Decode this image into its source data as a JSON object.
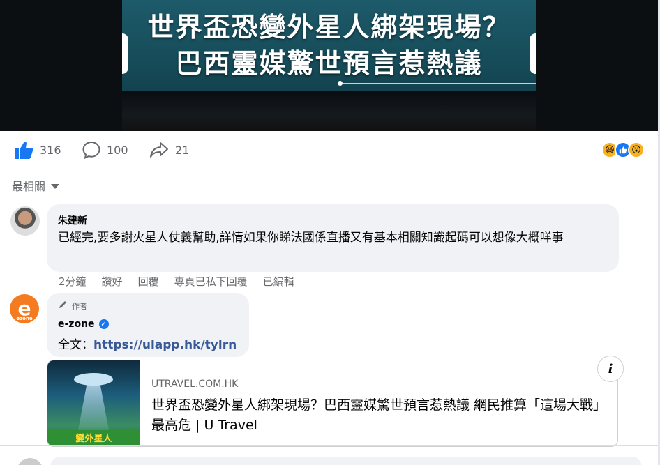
{
  "video": {
    "headline_line1": "世界盃恐變外星人綁架現場？",
    "headline_line2": "巴西靈媒驚世預言惹熱議"
  },
  "actions": {
    "likes": "316",
    "comments": "100",
    "shares": "21",
    "reactions": [
      "laugh",
      "like",
      "wow"
    ]
  },
  "sort": {
    "label": "最相關"
  },
  "comments": [
    {
      "author": "朱建新",
      "text": "已經完,要多謝火星人仗義幫助,詳情如果你睇法國係直播又有基本相關知識起碼可以想像大概咩事",
      "meta": {
        "time": "2分鐘",
        "like": "讚好",
        "reply": "回覆",
        "private_reply": "專頁已私下回覆",
        "edited": "已編輯"
      }
    },
    {
      "author_tag": "作者",
      "author": "e-zone",
      "avatar_letter": "e",
      "avatar_small": "ezone",
      "text_prefix": "全文：",
      "link": "https://ulapp.hk/tylrn"
    }
  ],
  "link_card": {
    "thumb_banner": "變外星人",
    "domain": "UTRAVEL.COM.HK",
    "title": "世界盃恐變外星人綁架現場？巴西靈媒驚世預言惹熱議 網民推算「這場大戰」最高危 | U Travel",
    "info_label": "i"
  },
  "colors": {
    "accent": "#1877f2",
    "link": "#385898",
    "secondary_text": "#65676b",
    "bubble": "#f0f2f5",
    "brand_orange": "#f47b20"
  }
}
